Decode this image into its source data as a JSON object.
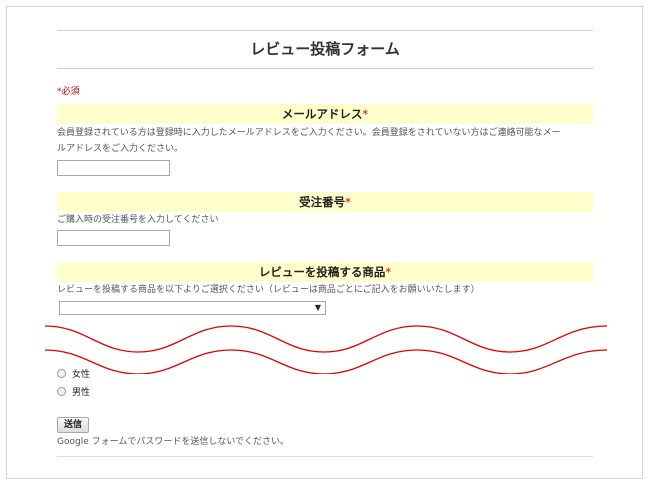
{
  "form": {
    "title": "レビュー投稿フォーム",
    "required_note": "*必須",
    "required_mark": "*"
  },
  "email": {
    "label": "メールアドレス",
    "help_line1": "会員登録されている方は登録時に入力したメールアドレスをご入力ください。会員登録をされていない方はご連絡可能なメー",
    "help_line2": "ルアドレスをご入力ください。",
    "value": ""
  },
  "order": {
    "label": "受注番号",
    "help": "ご購入時の受注番号を入力してください",
    "value": ""
  },
  "product": {
    "label": "レビューを投稿する商品",
    "help": "レビューを投稿する商品を以下よりご選択ください（レビューは商品ごとにご記入をお願いいたします）",
    "selected": "",
    "arrow": "▼"
  },
  "gender": {
    "options": [
      "女性",
      "男性"
    ]
  },
  "submit": {
    "label": "送信",
    "warning": "Google フォームでパスワードを送信しないでください。"
  },
  "colors": {
    "section_bg": "#ffffcc",
    "required": "#cc0000",
    "wave": "#e00000"
  }
}
